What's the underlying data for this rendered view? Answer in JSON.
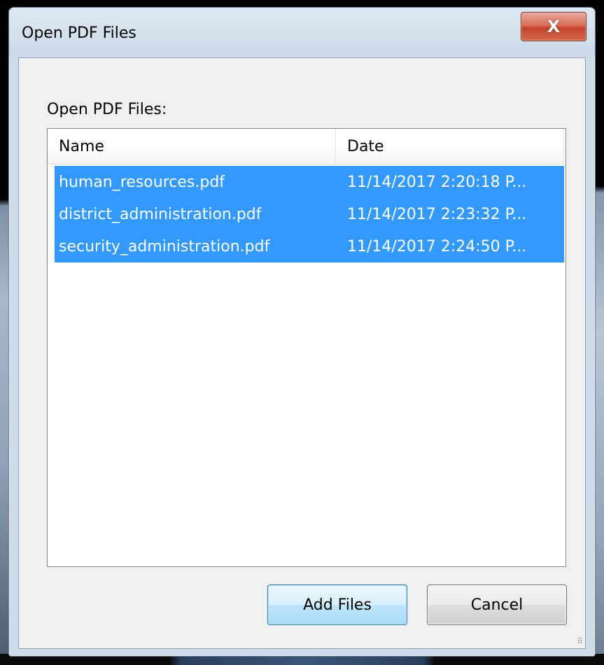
{
  "window": {
    "title": "Open PDF Files",
    "close_glyph": "X"
  },
  "content": {
    "label": "Open PDF Files:"
  },
  "list": {
    "columns": [
      "Name",
      "Date"
    ],
    "rows": [
      {
        "name": "human_resources.pdf",
        "date": "11/14/2017 2:20:18 P...",
        "selected": true
      },
      {
        "name": "district_administration.pdf",
        "date": "11/14/2017 2:23:32 P...",
        "selected": true
      },
      {
        "name": "security_administration.pdf",
        "date": "11/14/2017 2:24:50 P...",
        "selected": true
      }
    ]
  },
  "buttons": {
    "add_label": "Add Files",
    "cancel_label": "Cancel"
  },
  "colors": {
    "selection": "#3399ff",
    "close_button": "#c2432b"
  },
  "icons": {
    "close": "close-icon",
    "resize": "resize-grip-icon"
  }
}
